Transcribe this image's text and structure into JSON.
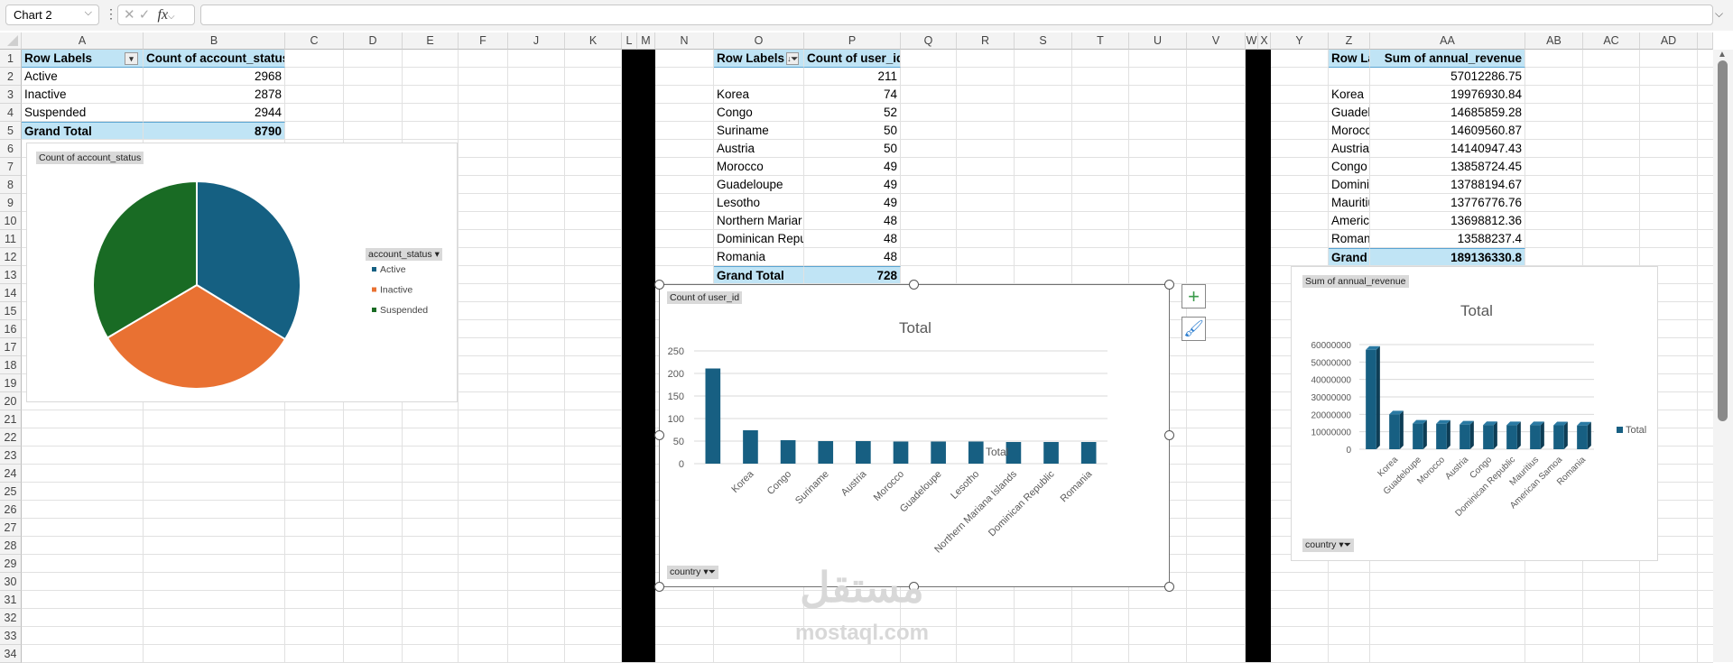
{
  "toolbar": {
    "name_box": "Chart 2",
    "cancel": "✕",
    "enter": "✓",
    "fx": "fx",
    "formula": ""
  },
  "columns": [
    "A",
    "B",
    "C",
    "D",
    "E",
    "F",
    "J",
    "K",
    "L",
    "M",
    "N",
    "O",
    "P",
    "Q",
    "R",
    "S",
    "T",
    "U",
    "V",
    "W",
    "X",
    "Y",
    "Z",
    "AA",
    "AB",
    "AC",
    "AD"
  ],
  "rows": [
    1,
    2,
    3,
    4,
    5,
    6,
    7,
    8,
    9,
    10,
    11,
    12,
    13,
    14,
    15,
    16,
    17,
    18,
    19,
    20,
    21,
    22,
    23,
    24,
    25,
    26,
    27,
    28,
    29,
    30,
    31,
    32,
    33,
    34
  ],
  "pivot1": {
    "header": [
      "Row Labels",
      "Count of account_status"
    ],
    "rows": [
      [
        "Active",
        "2968"
      ],
      [
        "Inactive",
        "2878"
      ],
      [
        "Suspended",
        "2944"
      ]
    ],
    "total": [
      "Grand Total",
      "8790"
    ]
  },
  "pivot2": {
    "header": [
      "Row Labels",
      "Count of user_id"
    ],
    "rows": [
      [
        "",
        "211"
      ],
      [
        "Korea",
        "74"
      ],
      [
        "Congo",
        "52"
      ],
      [
        "Suriname",
        "50"
      ],
      [
        "Austria",
        "50"
      ],
      [
        "Morocco",
        "49"
      ],
      [
        "Guadeloupe",
        "49"
      ],
      [
        "Lesotho",
        "49"
      ],
      [
        "Northern Mariar",
        "48"
      ],
      [
        "Dominican Repu",
        "48"
      ],
      [
        "Romania",
        "48"
      ]
    ],
    "total": [
      "Grand Total",
      "728"
    ]
  },
  "pivot3": {
    "header": [
      "Row La",
      "Sum of annual_revenue"
    ],
    "rows": [
      [
        "",
        "57012286.75"
      ],
      [
        "Korea",
        "19976930.84"
      ],
      [
        "Guadelou",
        "14685859.28"
      ],
      [
        "Morocco",
        "14609560.87"
      ],
      [
        "Austria",
        "14140947.43"
      ],
      [
        "Congo",
        "13858724.45"
      ],
      [
        "Dominica",
        "13788194.67"
      ],
      [
        "Mauritius",
        "13776776.76"
      ],
      [
        "American",
        "13698812.36"
      ],
      [
        "Romania",
        "13588237.4"
      ]
    ],
    "total": [
      "Grand Tot",
      "189136330.8"
    ]
  },
  "chart_data": [
    {
      "type": "pie",
      "field_button": "Count of account_status",
      "legend_title": "account_status",
      "legend_placement": "right",
      "categories": [
        "Active",
        "Inactive",
        "Suspended"
      ],
      "values": [
        2968,
        2878,
        2944
      ],
      "colors": [
        "#156082",
        "#e97132",
        "#196b24"
      ]
    },
    {
      "type": "bar",
      "title": "Total",
      "field_button": "Count of user_id",
      "axis_button": "country",
      "legend": [
        "Total"
      ],
      "legend_placement": "right",
      "categories": [
        "",
        "Korea",
        "Congo",
        "Suriname",
        "Austria",
        "Morocco",
        "Guadeloupe",
        "Lesotho",
        "Northern Mariana Islands",
        "Dominican Republic",
        "Romania"
      ],
      "values": [
        211,
        74,
        52,
        50,
        50,
        49,
        49,
        49,
        48,
        48,
        48
      ],
      "ylim": [
        0,
        250
      ],
      "yticks": [
        "0",
        "50",
        "100",
        "150",
        "200",
        "250"
      ],
      "grid": true,
      "color": "#175f82"
    },
    {
      "type": "bar",
      "title": "Total",
      "field_button": "Sum of annual_revenue",
      "axis_button": "country",
      "legend": [
        "Total"
      ],
      "legend_placement": "right",
      "categories": [
        "",
        "Korea",
        "Guadeloupe",
        "Morocco",
        "Austria",
        "Congo",
        "Dominican Republic",
        "Mauritius",
        "American Samoa",
        "Romania"
      ],
      "values": [
        57012286.75,
        19976930.84,
        14685859.28,
        14609560.87,
        14140947.43,
        13858724.45,
        13788194.67,
        13776776.76,
        13698812.36,
        13588237.4
      ],
      "ylim": [
        0,
        60000000
      ],
      "yticks": [
        "0",
        "10000000",
        "20000000",
        "30000000",
        "40000000",
        "50000000",
        "60000000"
      ],
      "grid": true,
      "style": "3d-column",
      "color": "#175f82"
    }
  ],
  "watermark": {
    "arabic": "مستقل",
    "latin": "mostaql.com"
  }
}
